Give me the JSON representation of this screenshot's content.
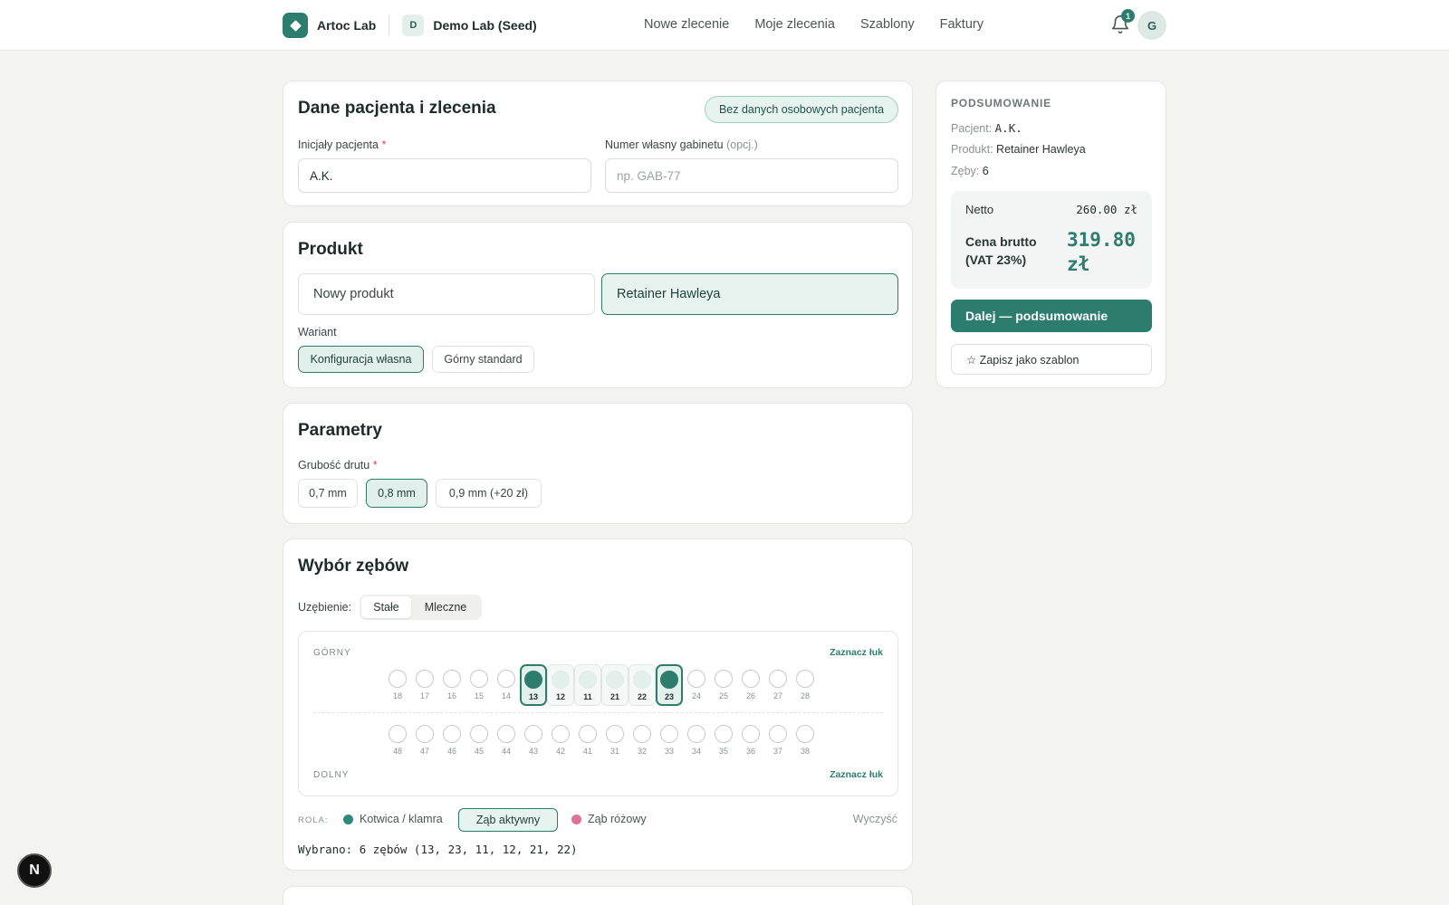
{
  "brand": {
    "name": "Artoc Lab",
    "lab_initial": "D",
    "lab_name": "Demo Lab (Seed)"
  },
  "nav": {
    "items": [
      "Nowe zlecenie",
      "Moje zlecenia",
      "Szablony",
      "Faktury"
    ]
  },
  "notifications": {
    "count": "1"
  },
  "user": {
    "initial": "G"
  },
  "patient_card": {
    "title": "Dane pacjenta i zlecenia",
    "privacy_badge": "Bez danych osobowych pacjenta",
    "initials_label": "Inicjały pacjenta",
    "initials_required": "*",
    "initials_value": "A.K.",
    "office_number_label": "Numer własny gabinetu",
    "office_number_optional": "(opcj.)",
    "office_number_placeholder": "np. GAB-77"
  },
  "product_card": {
    "title": "Produkt",
    "options": [
      "Nowy produkt",
      "Retainer Hawleya"
    ],
    "selected_option": "Retainer Hawleya",
    "variant_label": "Wariant",
    "variants": [
      "Konfiguracja własna",
      "Górny standard"
    ],
    "selected_variant": "Konfiguracja własna"
  },
  "params_card": {
    "title": "Parametry",
    "wire_label": "Grubość drutu",
    "wire_required": "*",
    "wire_options": [
      "0,7 mm",
      "0,8 mm",
      "0,9 mm (+20 zł)"
    ],
    "selected_wire": "0,8 mm"
  },
  "teeth_card": {
    "title": "Wybór zębów",
    "dentition_label": "Uzębienie:",
    "dentition_options": [
      "Stałe",
      "Mleczne"
    ],
    "selected_dentition": "Stałe",
    "upper_label": "GÓRNY",
    "lower_label": "DOLNY",
    "mark_arch": "Zaznacz łuk",
    "upper_teeth": [
      "18",
      "17",
      "16",
      "15",
      "14",
      "13",
      "12",
      "11",
      "21",
      "22",
      "23",
      "24",
      "25",
      "26",
      "27",
      "28"
    ],
    "lower_teeth": [
      "48",
      "47",
      "46",
      "45",
      "44",
      "43",
      "42",
      "41",
      "31",
      "32",
      "33",
      "34",
      "35",
      "36",
      "37",
      "38"
    ],
    "anchor_teeth": [
      "13",
      "23"
    ],
    "active_teeth": [
      "12",
      "11",
      "21",
      "22"
    ],
    "role_label": "ROLA:",
    "roles": {
      "anchor": "Kotwica / klamra",
      "active": "Ząb aktywny",
      "pink": "Ząb różowy"
    },
    "clear": "Wyczyść",
    "selected_summary": "Wybrano: 6 zębów (13, 23, 11, 12, 21, 22)"
  },
  "summary": {
    "title": "PODSUMOWANIE",
    "patient_label": "Pacjent:",
    "patient_value": "A.K.",
    "product_label": "Produkt:",
    "product_value": "Retainer Hawleya",
    "teeth_label": "Zęby:",
    "teeth_value": "6",
    "netto_label": "Netto",
    "netto_value": "260.00 zł",
    "brutto_label_1": "Cena brutto",
    "brutto_label_2": "(VAT 23%)",
    "brutto_value_1": "319.80",
    "brutto_value_2": "zł",
    "next_button": "Dalej — podsumowanie",
    "save_template_button": "☆ Zapisz jako szablon"
  },
  "dev_badge": "N",
  "colors": {
    "accent": "#2d7d6f",
    "anchor": "#2d8a7a",
    "pink": "#e0709a",
    "required": "#d6455c"
  }
}
